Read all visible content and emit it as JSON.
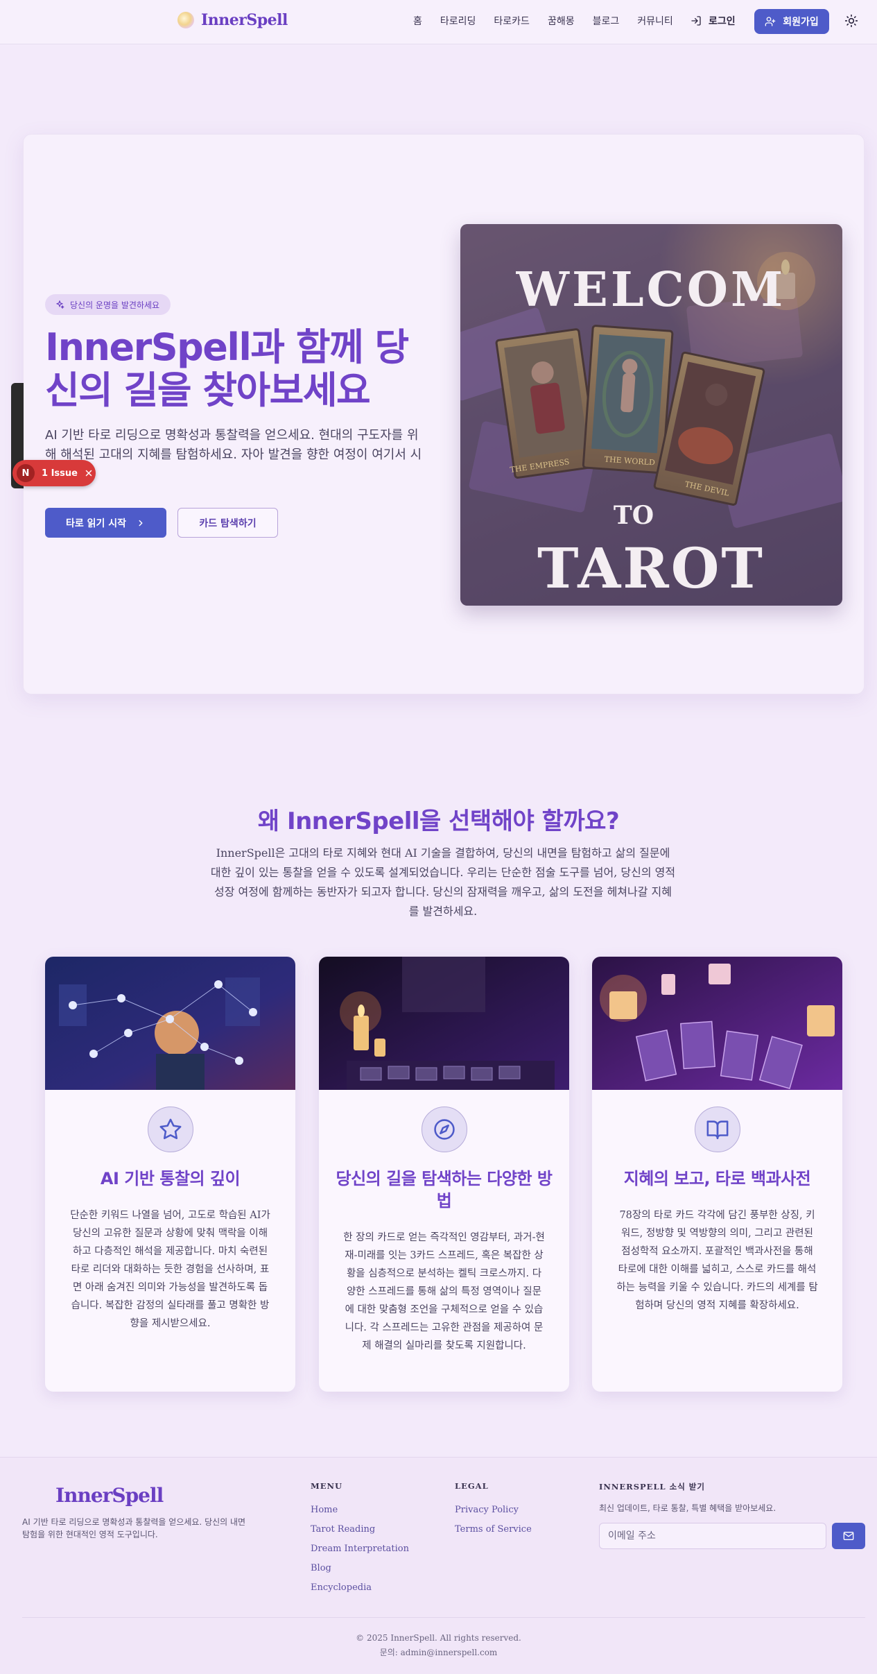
{
  "nav": {
    "brand": "InnerSpell",
    "links": [
      "홈",
      "타로리딩",
      "타로카드",
      "꿈해몽",
      "블로그",
      "커뮤니티"
    ],
    "login": "로그인",
    "signup": "회원가입"
  },
  "hero": {
    "badge": "당신의 운명을 발견하세요",
    "title": "InnerSpell과 함께 당신의 길을 찾아보세요",
    "subtitle": "AI 기반 타로 리딩으로 명확성과 통찰력을 얻으세요. 현대의 구도자를 위해 해석된 고대의 지혜를 탐험하세요. 자아 발견을 향한 여정이 여기서 시작됩니다.",
    "primary_button": "타로 읽기 시작",
    "secondary_button": "카드 탐색하기",
    "image_text_top": "WELCOM",
    "image_text_mid": "TO",
    "image_text_bottom": "TAROT",
    "card_labels": [
      "THE EMPRESS",
      "THE WORLD",
      "THE DEVIL"
    ]
  },
  "dev_overlay": {
    "avatar": "N",
    "issue_label": "1 Issue"
  },
  "why": {
    "title": "왜 InnerSpell을 선택해야 할까요?",
    "description": "InnerSpell은 고대의 타로 지혜와 현대 AI 기술을 결합하여, 당신의 내면을 탐험하고 삶의 질문에 대한 깊이 있는 통찰을 얻을 수 있도록 설계되었습니다. 우리는 단순한 점술 도구를 넘어, 당신의 영적 성장 여정에 함께하는 동반자가 되고자 합니다. 당신의 잠재력을 깨우고, 삶의 도전을 헤쳐나갈 지혜를 발견하세요.",
    "cards": [
      {
        "icon": "star-icon",
        "title": "AI 기반 통찰의 깊이",
        "text": "단순한 키워드 나열을 넘어, 고도로 학습된 AI가 당신의 고유한 질문과 상황에 맞춰 맥락을 이해하고 다층적인 해석을 제공합니다. 마치 숙련된 타로 리더와 대화하는 듯한 경험을 선사하며, 표면 아래 숨겨진 의미와 가능성을 발견하도록 돕습니다. 복잡한 감정의 실타래를 풀고 명확한 방향을 제시받으세요."
      },
      {
        "icon": "compass-icon",
        "title": "당신의 길을 탐색하는 다양한 방법",
        "text": "한 장의 카드로 얻는 즉각적인 영감부터, 과거-현재-미래를 잇는 3카드 스프레드, 혹은 복잡한 상황을 심층적으로 분석하는 켈틱 크로스까지. 다양한 스프레드를 통해 삶의 특정 영역이나 질문에 대한 맞춤형 조언을 구체적으로 얻을 수 있습니다. 각 스프레드는 고유한 관점을 제공하여 문제 해결의 실마리를 찾도록 지원합니다."
      },
      {
        "icon": "book-icon",
        "title": "지혜의 보고, 타로 백과사전",
        "text": "78장의 타로 카드 각각에 담긴 풍부한 상징, 키워드, 정방향 및 역방향의 의미, 그리고 관련된 점성학적 요소까지. 포괄적인 백과사전을 통해 타로에 대한 이해를 넓히고, 스스로 카드를 해석하는 능력을 키울 수 있습니다. 카드의 세계를 탐험하며 당신의 영적 지혜를 확장하세요."
      }
    ]
  },
  "footer": {
    "brand": "InnerSpell",
    "about": "AI 기반 타로 리딩으로 명확성과 통찰력을 얻으세요. 당신의 내면 탐험을 위한 현대적인 영적 도구입니다.",
    "menu_heading": "MENU",
    "menu": [
      "Home",
      "Tarot Reading",
      "Dream Interpretation",
      "Blog",
      "Encyclopedia"
    ],
    "legal_heading": "LEGAL",
    "legal": [
      "Privacy Policy",
      "Terms of Service"
    ],
    "news_heading": "INNERSPELL 소식 받기",
    "news_desc": "최신 업데이트, 타로 통찰, 특별 혜택을 받아보세요.",
    "email_placeholder": "이메일 주소",
    "copyright": "© 2025 InnerSpell. All rights reserved.",
    "contact": "문의: admin@innerspell.com"
  },
  "colors": {
    "accent": "#7043c8",
    "primary_button": "#4e5bc9",
    "background": "#f3eafa",
    "issue_badge": "#d83a3a"
  }
}
